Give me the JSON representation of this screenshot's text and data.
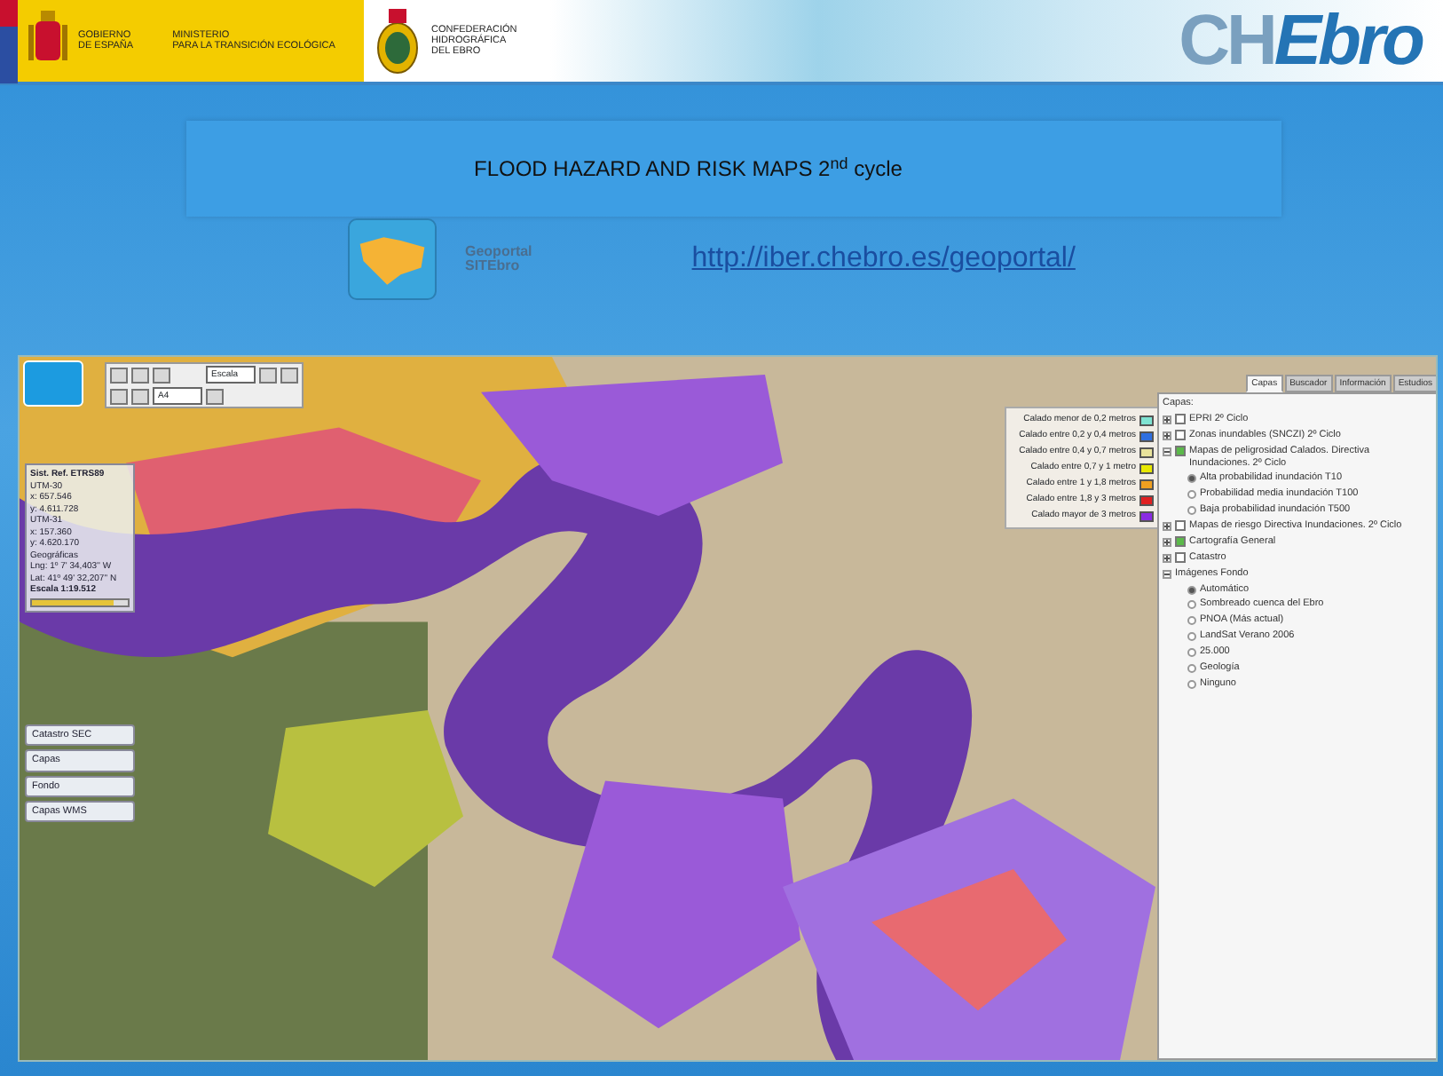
{
  "header": {
    "government": [
      "GOBIERNO",
      "DE ESPAÑA"
    ],
    "ministry": [
      "MINISTERIO",
      "PARA LA TRANSICIÓN ECOLÓGICA"
    ],
    "confederation": [
      "CONFEDERACIÓN",
      "HIDROGRÁFICA",
      "DEL EBRO"
    ],
    "brand": [
      "CH",
      "Ebro"
    ]
  },
  "title": "FLOOD HAZARD AND RISK MAPS 2$^{nd}$ cycle",
  "geoportal": {
    "logo_text": [
      "Geoportal",
      "SITEbro"
    ],
    "url": "http://iber.chebro.es/geoportal/"
  },
  "map_viewer": {
    "toolbar": {
      "dropdowns": [
        "Escala",
        "A4"
      ]
    },
    "coordinates": {
      "heading": "Sist. Ref. ETRS89",
      "lines": [
        "UTM-30",
        "x: 657.546",
        "y: 4.611.728",
        "UTM-31",
        "x: 157.360",
        "y: 4.620.170",
        "Geográficas",
        "Lng: 1º 7' 34,403'' W",
        "Lat: 41º 49' 32,207'' N"
      ],
      "scale": "Escala 1:19.512",
      "zoom": {
        "level": 0.86
      }
    },
    "side_buttons": [
      "Catastro SEC",
      "Capas",
      "Fondo",
      "Capas WMS"
    ],
    "legend": [
      {
        "label": "Calado menor de 0,2 metros",
        "color": "#7fe3d2"
      },
      {
        "label": "Calado entre 0,2 y 0,4 metros",
        "color": "#2f6fe0"
      },
      {
        "label": "Calado entre 0,4 y 0,7 metros",
        "color": "#e9e39c"
      },
      {
        "label": "Calado entre 0,7 y 1 metro",
        "color": "#e8e800"
      },
      {
        "label": "Calado entre 1 y 1,8 metros",
        "color": "#f0a020"
      },
      {
        "label": "Calado entre 1,8 y 3 metros",
        "color": "#e02020"
      },
      {
        "label": "Calado mayor de 3 metros",
        "color": "#8a2be2"
      }
    ],
    "tabs": [
      {
        "label": "Capas",
        "selected": true
      },
      {
        "label": "Buscador",
        "selected": false
      },
      {
        "label": "Información",
        "selected": false
      },
      {
        "label": "Estudios",
        "selected": false
      }
    ],
    "layers": {
      "heading": "Capas:",
      "items": [
        {
          "kind": "check",
          "label": "EPRI 2º Ciclo",
          "checked": false,
          "expanded": false
        },
        {
          "kind": "check",
          "label": "Zonas inundables (SNCZI) 2º Ciclo",
          "checked": false,
          "expanded": false
        },
        {
          "kind": "check",
          "label": "Mapas de peligrosidad Calados. Directiva Inundaciones. 2º Ciclo",
          "checked": true,
          "expanded": true,
          "children": [
            {
              "label": "Alta probabilidad inundación T10",
              "selected": true
            },
            {
              "label": "Probabilidad media inundación T100",
              "selected": false
            },
            {
              "label": "Baja probabilidad inundación T500",
              "selected": false
            }
          ]
        },
        {
          "kind": "check",
          "label": "Mapas de riesgo Directiva Inundaciones. 2º Ciclo",
          "checked": false,
          "expanded": false
        },
        {
          "kind": "check",
          "label": "Cartografía General",
          "checked": true,
          "expanded": false
        },
        {
          "kind": "check",
          "label": "Catastro",
          "checked": false,
          "expanded": false
        },
        {
          "kind": "folder",
          "label": "Imágenes Fondo",
          "expanded": true,
          "children": [
            {
              "label": "Automático",
              "selected": true
            },
            {
              "label": "Sombreado cuenca del Ebro",
              "selected": false
            },
            {
              "label": "PNOA (Más actual)",
              "selected": false
            },
            {
              "label": "LandSat Verano 2006",
              "selected": false
            },
            {
              "label": "25.000",
              "selected": false
            },
            {
              "label": "Geología",
              "selected": false
            },
            {
              "label": "Ninguno",
              "selected": false
            }
          ]
        }
      ]
    }
  }
}
